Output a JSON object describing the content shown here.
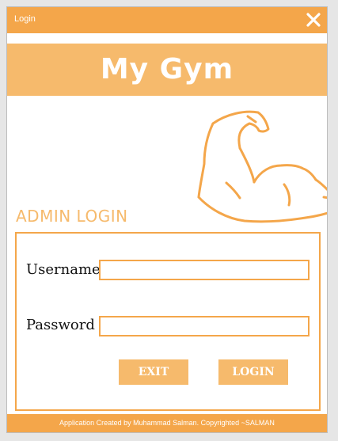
{
  "window": {
    "title": "Login"
  },
  "header": {
    "app_title": "My Gym"
  },
  "login": {
    "heading": "ADMIN LOGIN",
    "username_label": "Username",
    "password_label": "Password",
    "username_value": "",
    "password_value": "",
    "exit_label": "EXIT",
    "login_label": "LOGIN"
  },
  "footer": {
    "text": "Application Created by Muhammad Salman. Copyrighted ~SALMAN"
  },
  "icons": {
    "close": "close-icon",
    "logo": "flexed-bicep-icon"
  },
  "colors": {
    "accent": "#f4a64a",
    "accent_light": "#f6ba6c",
    "background": "#ffffff"
  }
}
